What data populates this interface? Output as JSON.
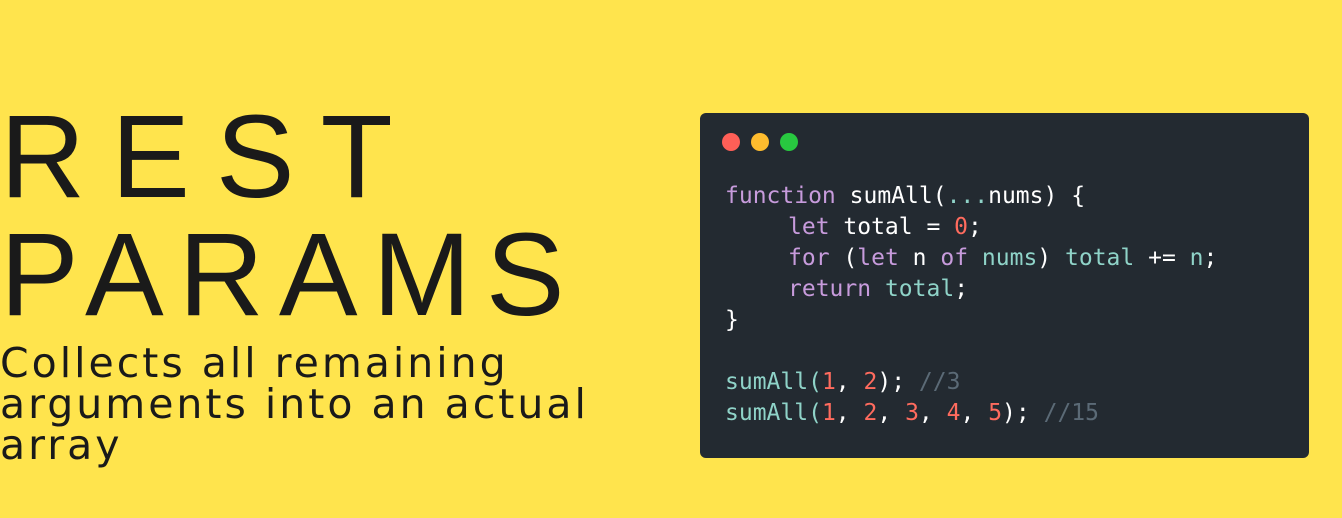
{
  "title": {
    "line1": "REST",
    "line2": "PARAMS"
  },
  "subtitle": "Collects all remaining arguments into an actual array",
  "window_controls": {
    "close_color": "#ff5f57",
    "minimize_color": "#febc2e",
    "zoom_color": "#28c840"
  },
  "code": {
    "lines": [
      {
        "indent": 0,
        "tokens": [
          {
            "text": "function",
            "kind": "keyword"
          },
          {
            "text": " sumAll(",
            "kind": "plain"
          },
          {
            "text": "...",
            "kind": "ident"
          },
          {
            "text": "nums) {",
            "kind": "plain"
          }
        ]
      },
      {
        "indent": 1,
        "tokens": [
          {
            "text": "let",
            "kind": "keyword"
          },
          {
            "text": " total = ",
            "kind": "plain"
          },
          {
            "text": "0",
            "kind": "number"
          },
          {
            "text": ";",
            "kind": "plain"
          }
        ]
      },
      {
        "indent": 1,
        "tokens": [
          {
            "text": "for",
            "kind": "keyword"
          },
          {
            "text": " (",
            "kind": "plain"
          },
          {
            "text": "let",
            "kind": "keyword"
          },
          {
            "text": " n ",
            "kind": "plain"
          },
          {
            "text": "of",
            "kind": "keyword"
          },
          {
            "text": " ",
            "kind": "plain"
          },
          {
            "text": "nums",
            "kind": "ident"
          },
          {
            "text": ") ",
            "kind": "plain"
          },
          {
            "text": "total",
            "kind": "ident"
          },
          {
            "text": " += ",
            "kind": "plain"
          },
          {
            "text": "n",
            "kind": "ident"
          },
          {
            "text": ";",
            "kind": "plain"
          }
        ]
      },
      {
        "indent": 1,
        "tokens": [
          {
            "text": "return",
            "kind": "keyword"
          },
          {
            "text": " ",
            "kind": "plain"
          },
          {
            "text": "total",
            "kind": "ident"
          },
          {
            "text": ";",
            "kind": "plain"
          }
        ]
      },
      {
        "indent": 0,
        "tokens": [
          {
            "text": "}",
            "kind": "plain"
          }
        ]
      },
      {
        "indent": 0,
        "tokens": []
      },
      {
        "indent": 0,
        "tokens": [
          {
            "text": "sumAll(",
            "kind": "ident"
          },
          {
            "text": "1",
            "kind": "number"
          },
          {
            "text": ", ",
            "kind": "plain"
          },
          {
            "text": "2",
            "kind": "number"
          },
          {
            "text": "); ",
            "kind": "plain"
          },
          {
            "text": "//3",
            "kind": "comment"
          }
        ]
      },
      {
        "indent": 0,
        "tokens": [
          {
            "text": "sumAll(",
            "kind": "ident"
          },
          {
            "text": "1",
            "kind": "number"
          },
          {
            "text": ", ",
            "kind": "plain"
          },
          {
            "text": "2",
            "kind": "number"
          },
          {
            "text": ", ",
            "kind": "plain"
          },
          {
            "text": "3",
            "kind": "number"
          },
          {
            "text": ", ",
            "kind": "plain"
          },
          {
            "text": "4",
            "kind": "number"
          },
          {
            "text": ", ",
            "kind": "plain"
          },
          {
            "text": "5",
            "kind": "number"
          },
          {
            "text": "); ",
            "kind": "plain"
          },
          {
            "text": "//15",
            "kind": "comment"
          }
        ]
      }
    ]
  }
}
